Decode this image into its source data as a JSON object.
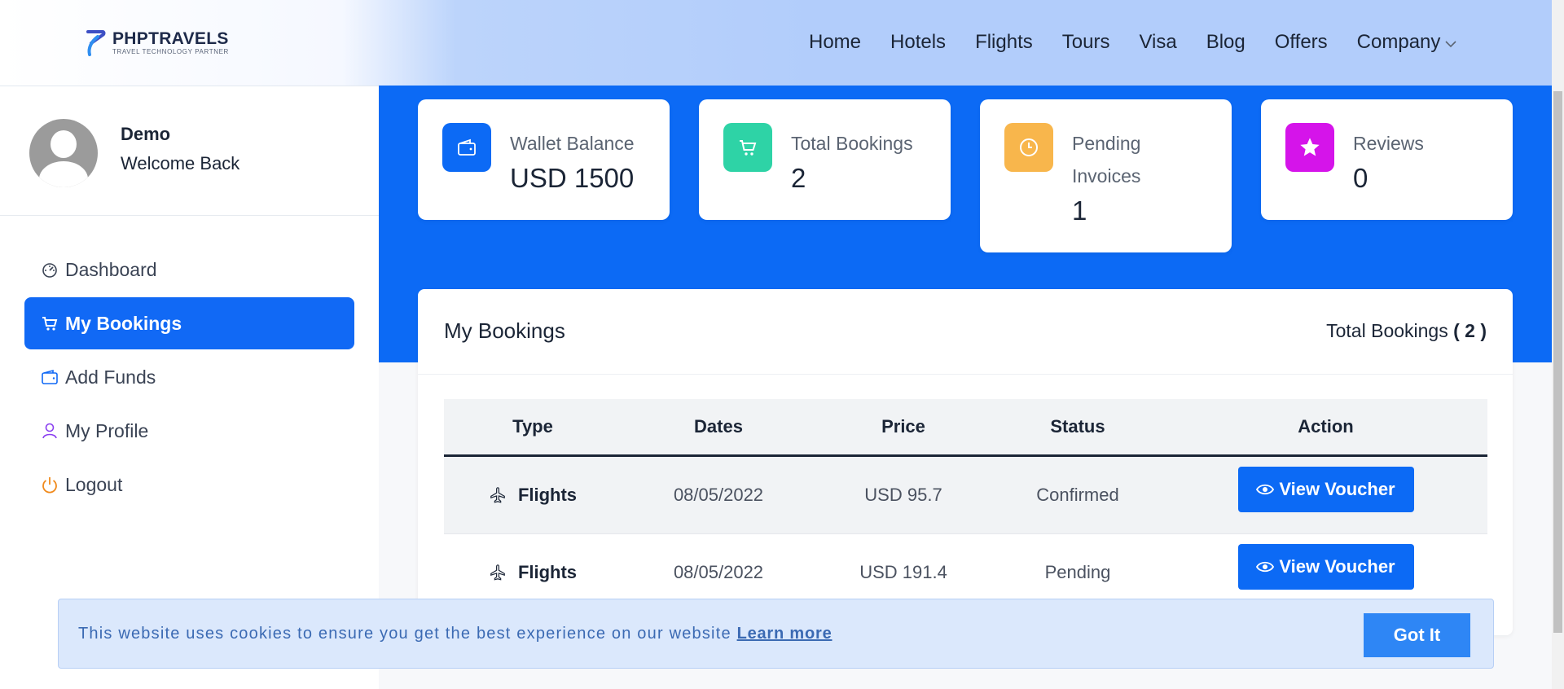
{
  "brand": {
    "name": "PHPTRAVELS",
    "tagline": "TRAVEL TECHNOLOGY PARTNER",
    "color": "#1e2a4a"
  },
  "nav": {
    "items": [
      "Home",
      "Hotels",
      "Flights",
      "Tours",
      "Visa",
      "Blog",
      "Offers",
      "Company"
    ],
    "dropdown_icon": "chevron-down-icon"
  },
  "user": {
    "name": "Demo",
    "greeting": "Welcome Back",
    "avatar_icon": "user-avatar-icon"
  },
  "sidebar": {
    "items": [
      {
        "label": "Dashboard",
        "icon": "gauge-icon",
        "active": false
      },
      {
        "label": "My Bookings",
        "icon": "cart-icon",
        "active": true
      },
      {
        "label": "Add Funds",
        "icon": "wallet-icon",
        "active": false
      },
      {
        "label": "My Profile",
        "icon": "user-icon",
        "active": false
      },
      {
        "label": "Logout",
        "icon": "power-icon",
        "active": false
      }
    ]
  },
  "stats": [
    {
      "label": "Wallet Balance",
      "value": "USD 1500",
      "icon": "wallet-icon",
      "color": "#0c6af5"
    },
    {
      "label": "Total Bookings",
      "value": "2",
      "icon": "cart-icon",
      "color": "#2ed3a6"
    },
    {
      "label": "Pending Invoices",
      "value": "1",
      "icon": "clock-icon",
      "color": "#f8b64c"
    },
    {
      "label": "Reviews",
      "value": "0",
      "icon": "star-icon",
      "color": "#d514ea"
    }
  ],
  "bookings": {
    "title": "My Bookings",
    "total_label": "Total Bookings",
    "total_value": "( 2 )",
    "columns": [
      "Type",
      "Dates",
      "Price",
      "Status",
      "Action"
    ],
    "rows": [
      {
        "type": "Flights",
        "date": "08/05/2022",
        "price": "USD 95.7",
        "status": "Confirmed",
        "action": "View Voucher"
      },
      {
        "type": "Flights",
        "date": "08/05/2022",
        "price": "USD 191.4",
        "status": "Pending",
        "action": "View Voucher"
      }
    ]
  },
  "cookie": {
    "text": "This website uses cookies to ensure you get the best experience on our website",
    "link": "Learn more",
    "button": "Got It"
  },
  "colors": {
    "primary": "#0c6af5",
    "header_tint": "#b2cdfb",
    "cookie_bg": "#dbe8fc"
  }
}
